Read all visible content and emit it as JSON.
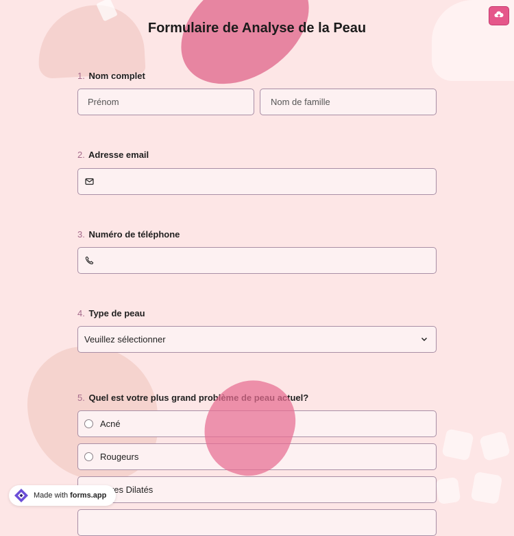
{
  "form": {
    "title": "Formulaire de Analyse de la Peau"
  },
  "questions": [
    {
      "number": "1.",
      "label": "Nom complet",
      "first_name_placeholder": "Prénom",
      "last_name_placeholder": "Nom de famille"
    },
    {
      "number": "2.",
      "label": "Adresse email",
      "icon": "envelope-icon",
      "value": ""
    },
    {
      "number": "3.",
      "label": "Numéro de téléphone",
      "icon": "phone-icon",
      "value": ""
    },
    {
      "number": "4.",
      "label": "Type de peau",
      "selected": "Veuillez sélectionner"
    },
    {
      "number": "5.",
      "label": "Quel est votre plus grand problème de peau actuel?",
      "options": [
        "Acné",
        "Rougeurs",
        "Pores Dilatés"
      ]
    }
  ],
  "toolbar": {
    "upload_icon": "cloud-upload-icon"
  },
  "badge": {
    "prefix": "Made with",
    "brand": "forms.app"
  },
  "colors": {
    "background": "#fde6e6",
    "accent": "#e5578a",
    "field_bg": "#fdf1f2",
    "field_border": "#a88ea5"
  }
}
